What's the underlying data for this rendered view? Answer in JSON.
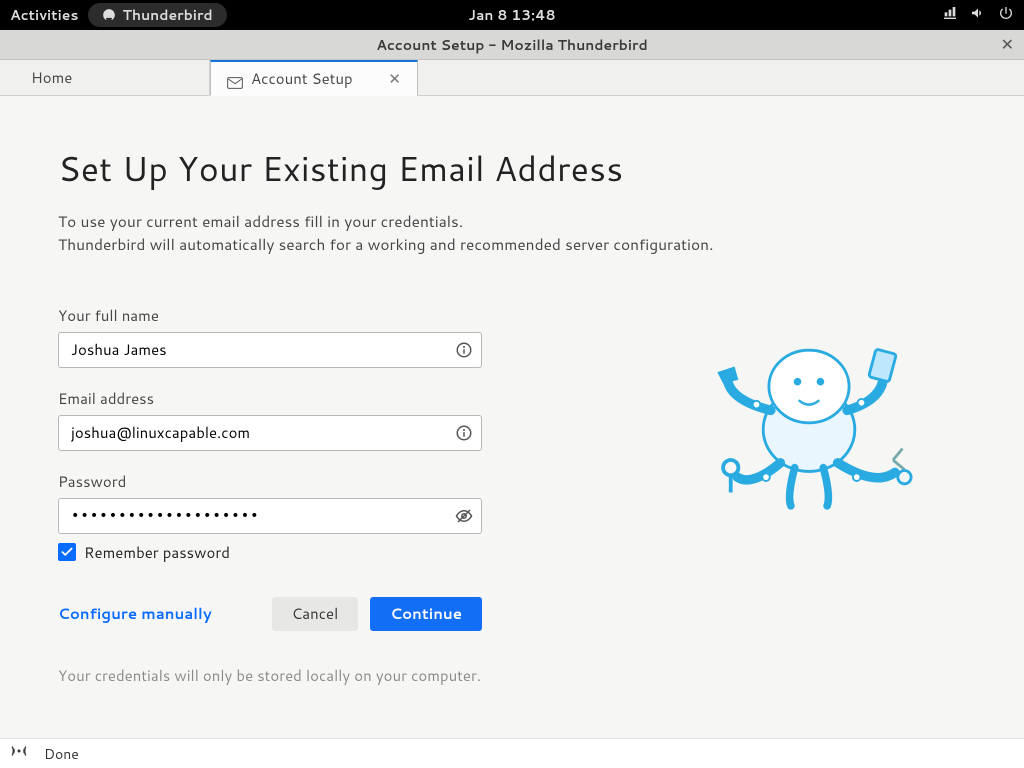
{
  "topbar": {
    "activities": "Activities",
    "app_name": "Thunderbird",
    "clock": "Jan 8  13:48"
  },
  "window": {
    "title": "Account Setup - Mozilla Thunderbird"
  },
  "tabs": {
    "home": "Home",
    "active": "Account Setup"
  },
  "page": {
    "heading": "Set Up Your Existing Email Address",
    "lead1": "To use your current email address fill in your credentials.",
    "lead2": "Thunderbird will automatically search for a working and recommended server configuration.",
    "name_label": "Your full name",
    "name_value": "Joshua James",
    "email_label": "Email address",
    "email_value": "joshua@linuxcapable.com",
    "password_label": "Password",
    "password_value": "••••••••••••••••••••",
    "remember_label": "Remember password",
    "configure_manually": "Configure manually",
    "cancel": "Cancel",
    "continue": "Continue",
    "note": "Your credentials will only be stored locally on your computer."
  },
  "statusbar": {
    "text": "Done"
  }
}
